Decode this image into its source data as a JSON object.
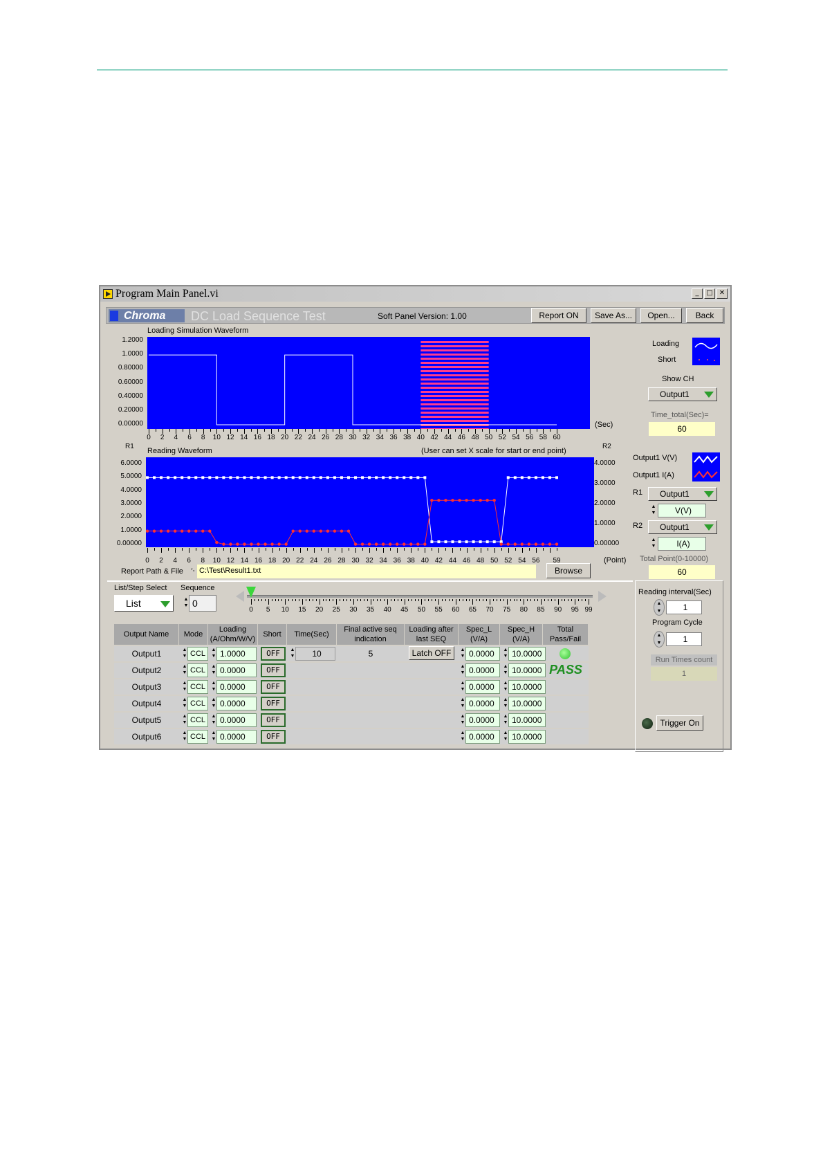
{
  "window": {
    "title": "Program Main Panel.vi",
    "min": "_",
    "max": "□",
    "close": "✕"
  },
  "header": {
    "logo": "Chroma",
    "app_title": "DC Load Sequence Test",
    "version": "Soft Panel Version: 1.00",
    "buttons": [
      "Report ON",
      "Save As...",
      "Open...",
      "Back"
    ]
  },
  "sim_chart": {
    "title": "Loading Simulation Waveform",
    "yticks": [
      "1.2000",
      "1.0000",
      "0.80000",
      "0.60000",
      "0.40000",
      "0.20000",
      "0.00000"
    ],
    "xticks": [
      "0",
      "2",
      "4",
      "6",
      "8",
      "10",
      "12",
      "14",
      "16",
      "18",
      "20",
      "22",
      "24",
      "26",
      "28",
      "30",
      "32",
      "34",
      "36",
      "38",
      "40",
      "42",
      "44",
      "46",
      "48",
      "50",
      "52",
      "54",
      "56",
      "58",
      "60"
    ],
    "x_unit": "(Sec)",
    "legend": {
      "loading": "Loading",
      "short": "Short"
    },
    "show_ch_label": "Show CH",
    "show_ch_value": "Output1",
    "time_total_label": "Time_total(Sec)=",
    "time_total_value": "60"
  },
  "chart_data": [
    {
      "type": "line",
      "title": "Loading Simulation Waveform",
      "xlabel": "(Sec)",
      "xlim": [
        0,
        60
      ],
      "ylim": [
        0,
        1.2
      ],
      "series": [
        {
          "name": "Loading",
          "x": [
            0,
            10,
            10,
            20,
            20,
            30,
            30,
            40,
            40,
            50,
            50,
            60
          ],
          "y": [
            1,
            1,
            0,
            0,
            1,
            1,
            0,
            0,
            0,
            0,
            0,
            0
          ]
        },
        {
          "name": "Short",
          "x": [
            40,
            50
          ],
          "y": [
            1.2,
            1.2
          ]
        }
      ]
    },
    {
      "type": "line",
      "title": "Reading Waveform",
      "xlabel": "(Point)",
      "xlim": [
        0,
        59
      ],
      "ylim": [
        0,
        6
      ],
      "y2lim": [
        0,
        4
      ],
      "series": [
        {
          "name": "Output1 V(V)",
          "x": [
            0,
            1,
            2,
            3,
            4,
            5,
            6,
            7,
            8,
            9,
            10,
            11,
            12,
            13,
            14,
            15,
            16,
            17,
            18,
            19,
            20,
            21,
            22,
            23,
            24,
            25,
            26,
            27,
            28,
            29,
            30,
            31,
            32,
            33,
            34,
            35,
            36,
            37,
            38,
            39,
            40,
            41,
            42,
            43,
            44,
            45,
            46,
            47,
            48,
            49,
            50,
            51,
            52,
            53,
            54,
            55,
            56,
            57,
            58,
            59
          ],
          "y": [
            5,
            5,
            5,
            5,
            5,
            5,
            5,
            5,
            5,
            5,
            5,
            5,
            5,
            5,
            5,
            5,
            5,
            5,
            5,
            5,
            5,
            5,
            5,
            5,
            5,
            5,
            5,
            5,
            5,
            5,
            5,
            5,
            5,
            5,
            5,
            5,
            5,
            5,
            5,
            5,
            5,
            0.2,
            0.2,
            0.2,
            0.2,
            0.2,
            0.2,
            0.2,
            0.2,
            0.2,
            0.2,
            0.2,
            5,
            5,
            5,
            5,
            5,
            5,
            5,
            5
          ]
        },
        {
          "name": "Output1 I(A)",
          "x": [
            0,
            1,
            2,
            3,
            4,
            5,
            6,
            7,
            8,
            9,
            10,
            11,
            12,
            13,
            14,
            15,
            16,
            17,
            18,
            19,
            20,
            21,
            22,
            23,
            24,
            25,
            26,
            27,
            28,
            29,
            30,
            31,
            32,
            33,
            34,
            35,
            36,
            37,
            38,
            39,
            40,
            41,
            42,
            43,
            44,
            45,
            46,
            47,
            48,
            49,
            50,
            51,
            52,
            53,
            54,
            55,
            56,
            57,
            58,
            59
          ],
          "y": [
            1,
            1,
            1,
            1,
            1,
            1,
            1,
            1,
            1,
            1,
            0.15,
            0.02,
            0.02,
            0.02,
            0.02,
            0.02,
            0.02,
            0.02,
            0.02,
            0.02,
            0.02,
            1,
            1,
            1,
            1,
            1,
            1,
            1,
            1,
            1,
            0.02,
            0.02,
            0.02,
            0.02,
            0.02,
            0.02,
            0.02,
            0.02,
            0.02,
            0.02,
            0.02,
            3.3,
            3.3,
            3.3,
            3.3,
            3.3,
            3.3,
            3.3,
            3.3,
            3.3,
            3.3,
            0.02,
            0.02,
            0.02,
            0.02,
            0.02,
            0.02,
            0.02,
            0.02,
            0.02
          ]
        }
      ]
    }
  ],
  "read_chart": {
    "title": "Reading Waveform",
    "note": "(User can set X scale for start or end point)",
    "r1": "R1",
    "r2": "R2",
    "yticks_left": [
      "6.0000",
      "5.0000",
      "4.0000",
      "3.0000",
      "2.0000",
      "1.0000",
      "0.00000"
    ],
    "yticks_right": [
      "4.0000",
      "3.0000",
      "2.0000",
      "1.0000",
      "0.00000"
    ],
    "xticks": [
      "0",
      "2",
      "4",
      "6",
      "8",
      "10",
      "12",
      "14",
      "16",
      "18",
      "20",
      "22",
      "24",
      "26",
      "28",
      "30",
      "32",
      "34",
      "36",
      "38",
      "40",
      "42",
      "44",
      "46",
      "48",
      "50",
      "52",
      "54",
      "56",
      "59"
    ],
    "x_unit": "(Point)",
    "legend": {
      "v": "Output1 V(V)",
      "i": "Output1 I(A)"
    },
    "r1_label": "R1",
    "r1_value": "Output1",
    "r1_unit": "V(V)",
    "r2_label": "R2",
    "r2_value": "Output1",
    "r2_unit": "I(A)",
    "total_point_label": "Total Point(0-10000)",
    "total_point_value": "60"
  },
  "report": {
    "label": "Report Path & File",
    "path": "C:\\Test\\Result1.txt",
    "browse": "Browse"
  },
  "sequence": {
    "list_label": "List/Step Select",
    "list_value": "List",
    "seq_label": "Sequence",
    "seq_value": "0",
    "slider_ticks": [
      "0",
      "5",
      "10",
      "15",
      "20",
      "25",
      "30",
      "35",
      "40",
      "45",
      "50",
      "55",
      "60",
      "65",
      "70",
      "75",
      "80",
      "85",
      "90",
      "95",
      "99"
    ],
    "slider_value": 0
  },
  "table": {
    "headers": [
      "Output Name",
      "Mode",
      "Loading (A/Ohm/W/V)",
      "Short",
      "Time(Sec)",
      "Final active seq indication",
      "Loading after last SEQ",
      "Spec_L (V/A)",
      "Spec_H (V/A)",
      "Total Pass/Fail"
    ],
    "rows": [
      {
        "name": "Output1",
        "mode": "CCL",
        "loading": "1.0000",
        "short": "OFF",
        "spec_l": "0.0000",
        "spec_h": "10.0000"
      },
      {
        "name": "Output2",
        "mode": "CCL",
        "loading": "0.0000",
        "short": "OFF",
        "spec_l": "0.0000",
        "spec_h": "10.0000"
      },
      {
        "name": "Output3",
        "mode": "CCL",
        "loading": "0.0000",
        "short": "OFF",
        "spec_l": "0.0000",
        "spec_h": "10.0000"
      },
      {
        "name": "Output4",
        "mode": "CCL",
        "loading": "0.0000",
        "short": "OFF",
        "spec_l": "0.0000",
        "spec_h": "10.0000"
      },
      {
        "name": "Output5",
        "mode": "CCL",
        "loading": "0.0000",
        "short": "OFF",
        "spec_l": "0.0000",
        "spec_h": "10.0000"
      },
      {
        "name": "Output6",
        "mode": "CCL",
        "loading": "0.0000",
        "short": "OFF",
        "spec_l": "0.0000",
        "spec_h": "10.0000"
      }
    ],
    "time_value": "10",
    "final_active": "5",
    "latch": "Latch OFF",
    "pass": "PASS"
  },
  "side": {
    "reading_interval_label": "Reading interval(Sec)",
    "reading_interval": "1",
    "program_cycle_label": "Program Cycle",
    "program_cycle": "1",
    "run_times_label": "Run Times count",
    "run_times": "1",
    "trigger": "Trigger On"
  },
  "colors": {
    "plot_bg": "#0000ff",
    "voltage": "#ffffff",
    "current": "#ff3030",
    "pass": "#1f8f1f",
    "led_on": "#33dd33"
  }
}
